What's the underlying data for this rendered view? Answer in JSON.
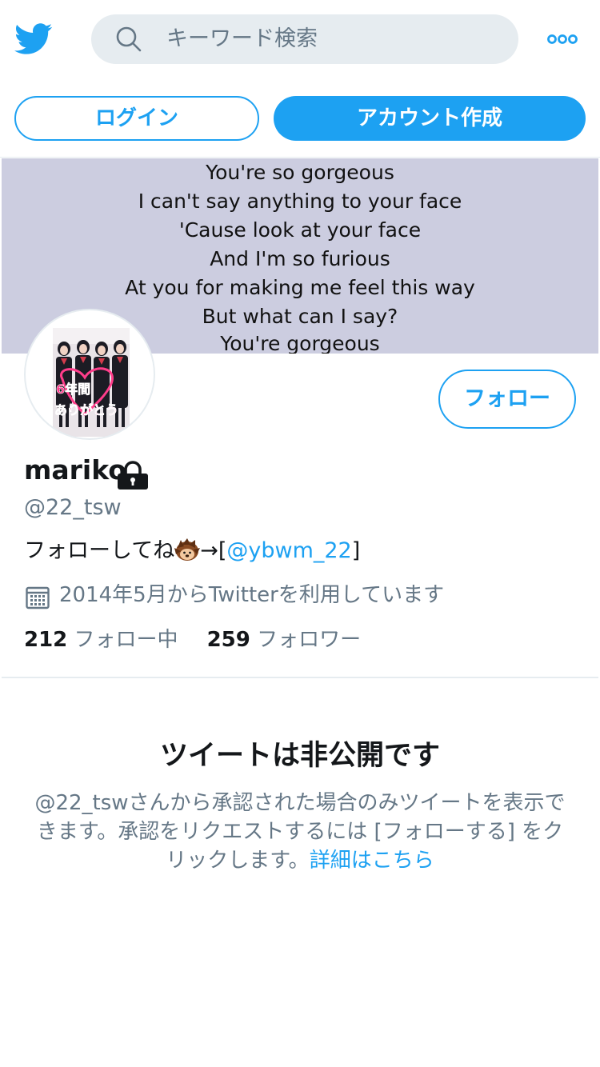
{
  "header": {
    "search_placeholder": "キーワード検索",
    "login_label": "ログイン",
    "signup_label": "アカウント作成"
  },
  "banner": {
    "lines": [
      "You're so gorgeous",
      "I can't say anything to your face",
      "'Cause look at your face",
      "And I'm so furious",
      "At you for making me feel this way",
      "But what can I say?",
      "You're gorgeous"
    ]
  },
  "avatar": {
    "overlay_text_1": "6年間",
    "overlay_text_2": "ありがとう"
  },
  "profile": {
    "follow_label": "フォロー",
    "name": "mariko",
    "handle": "@22_tsw",
    "bio_text": "フォローしてね",
    "bio_arrow": "→[",
    "bio_mention": "@ybwm_22",
    "bio_close": "]",
    "joined": "2014年5月からTwitterを利用しています",
    "following_count": "212",
    "following_label": "フォロー中",
    "followers_count": "259",
    "followers_label": "フォロワー"
  },
  "protected": {
    "title": "ツイートは非公開です",
    "body": "@22_tswさんから承認された場合のみツイートを表示できます。承認をリクエストするには [フォローする] をクリックします。",
    "link": "詳細はこちら"
  },
  "icons": {
    "logo": "twitter-bird-icon",
    "search": "search-icon",
    "more": "more-dots-icon",
    "lock": "lock-icon",
    "calendar": "calendar-icon",
    "hedgehog": "hedgehog-emoji-icon"
  },
  "colors": {
    "accent": "#1da1f2",
    "secondary_text": "#657786",
    "search_bg": "#e6ecf0",
    "banner_bg": "#cccde0"
  }
}
